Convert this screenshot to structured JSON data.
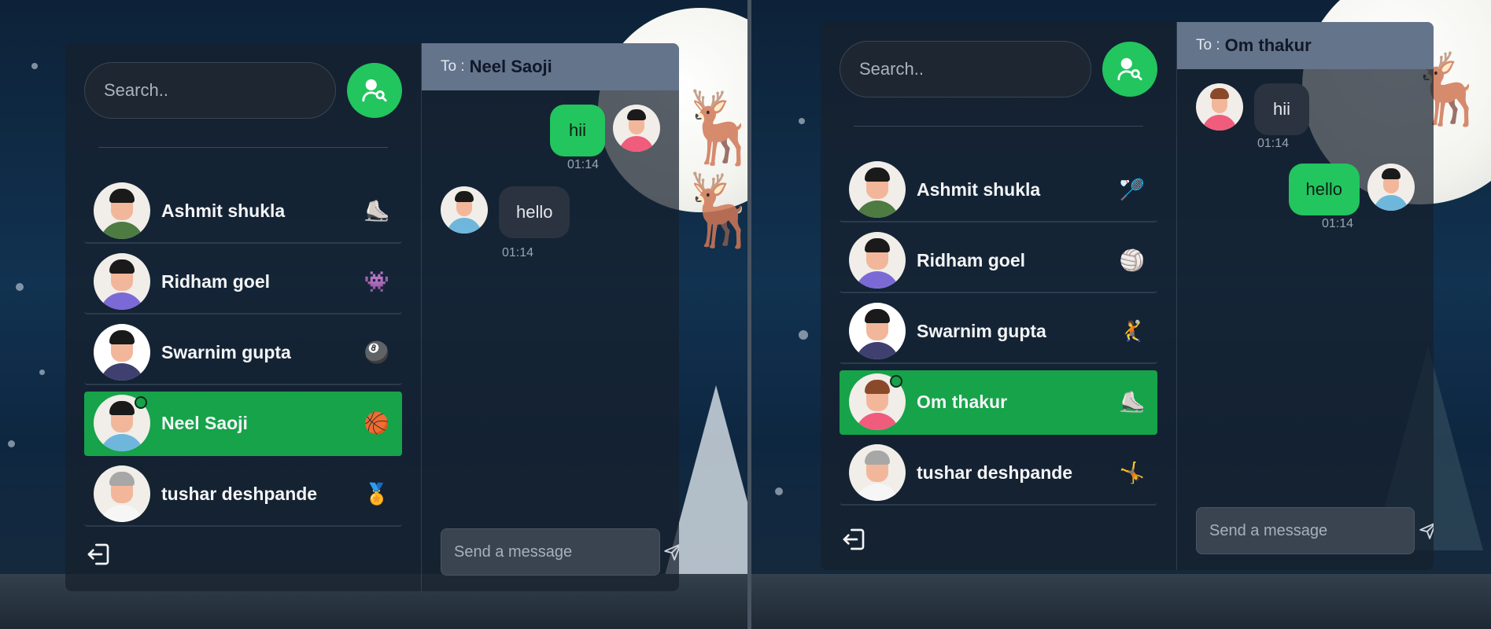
{
  "search": {
    "placeholder": "Search.."
  },
  "composer": {
    "placeholder": "Send a message"
  },
  "colors": {
    "accent": "#22c55e",
    "active_row": "#16a34a",
    "header": "#64748b"
  },
  "left_window": {
    "chat": {
      "to_label": "To :",
      "to_name": "Neel Saoji"
    },
    "conversations": [
      {
        "name": "Ashmit shukla",
        "emoji": "⛸️",
        "active": false,
        "online": false
      },
      {
        "name": "Ridham goel",
        "emoji": "👾",
        "active": false,
        "online": false
      },
      {
        "name": "Swarnim gupta",
        "emoji": "🎱",
        "active": false,
        "online": false
      },
      {
        "name": "Neel Saoji",
        "emoji": "🏀",
        "active": true,
        "online": true
      },
      {
        "name": "tushar deshpande",
        "emoji": "🏅",
        "active": false,
        "online": false
      }
    ],
    "messages": [
      {
        "text": "hii",
        "time": "01:14",
        "direction": "out"
      },
      {
        "text": "hello",
        "time": "01:14",
        "direction": "in"
      }
    ]
  },
  "right_window": {
    "chat": {
      "to_label": "To :",
      "to_name": "Om thakur"
    },
    "conversations": [
      {
        "name": "Ashmit shukla",
        "emoji": "🏸",
        "active": false,
        "online": false
      },
      {
        "name": "Ridham goel",
        "emoji": "🏐",
        "active": false,
        "online": false
      },
      {
        "name": "Swarnim gupta",
        "emoji": "🤾",
        "active": false,
        "online": false
      },
      {
        "name": "Om thakur",
        "emoji": "⛸️",
        "active": true,
        "online": true
      },
      {
        "name": "tushar deshpande",
        "emoji": "🤸",
        "active": false,
        "online": false
      }
    ],
    "messages": [
      {
        "text": "hii",
        "time": "01:14",
        "direction": "in"
      },
      {
        "text": "hello",
        "time": "01:14",
        "direction": "out"
      }
    ]
  }
}
